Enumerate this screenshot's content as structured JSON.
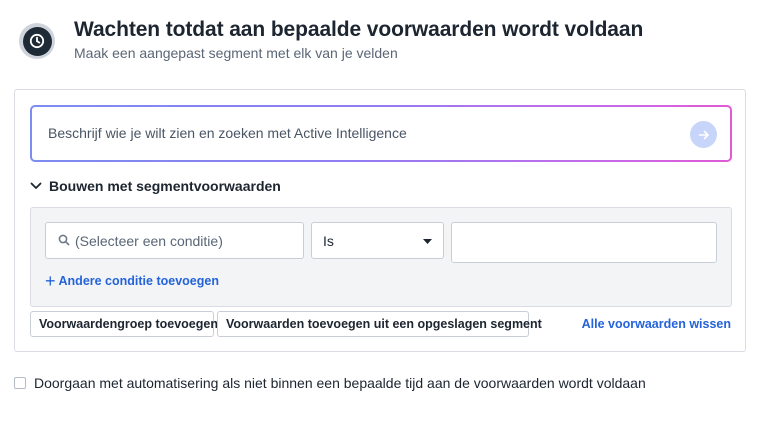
{
  "header": {
    "icon": "clock-icon",
    "title": "Wachten totdat aan bepaalde voorwaarden wordt voldaan",
    "subtitle": "Maak een aangepast segment met elk van je velden"
  },
  "ai_search": {
    "placeholder": "Beschrijf wie je wilt zien en zoeken met Active Intelligence",
    "submit_icon": "arrow-right-icon"
  },
  "builder": {
    "section_label": "Bouwen met segmentvoorwaarden",
    "condition_placeholder": "(Selecteer een conditie)",
    "operator_value": "Is",
    "value": "",
    "add_condition_label": "Andere conditie toevoegen"
  },
  "actions": {
    "add_group_label": "Voorwaardengroep toevoegen",
    "add_saved_label": "Voorwaarden toevoegen uit een opgeslagen segment",
    "clear_all_label": "Alle voorwaarden wissen"
  },
  "continue_option": {
    "label": "Doorgaan met automatisering als niet binnen een bepaalde tijd aan de voorwaarden wordt voldaan",
    "checked": false
  },
  "colors": {
    "accent": "#2463d9",
    "gradient_start": "#7c8cf0",
    "gradient_end": "#e05ad6",
    "header_icon_bg": "#1f2a37"
  }
}
